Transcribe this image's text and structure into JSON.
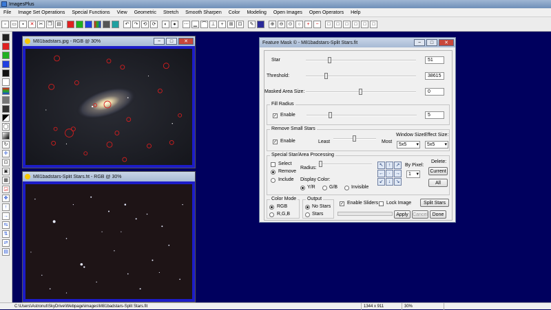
{
  "app": {
    "title": "ImagesPlus"
  },
  "menu": [
    "File",
    "Image Set Operations",
    "Special Functions",
    "View",
    "Geometric",
    "Stretch",
    "Smooth Sharpen",
    "Color",
    "Modeling",
    "Open Images",
    "Open Operators",
    "Help"
  ],
  "window1": {
    "title": "M81badstars.jpg - RGB @ 30%"
  },
  "window2": {
    "title": "M81badstars-Split Stars.fit - RGB @ 30%"
  },
  "dialog": {
    "title": "Feature Mask © - M81badstars-Split Stars.fit",
    "star": {
      "label": "Star",
      "value": "51",
      "level": 0.22
    },
    "threshold": {
      "label": "Threshold:",
      "value": "38615",
      "level": 0.19
    },
    "masked_area": {
      "label": "Masked Area Size:",
      "value": "0",
      "level": 0.5
    },
    "fill_radius": {
      "group": "Fill Radius",
      "enable_label": "Enable",
      "enabled": true,
      "value": "5",
      "level": 0.22
    },
    "remove_small": {
      "group": "Remove Small Stars",
      "enable_label": "Enable",
      "enabled": true,
      "least": "Least",
      "most": "Most",
      "level": 0.5,
      "window_size_label": "Window Size:",
      "window_size": "5x5",
      "effect_size_label": "Effect Size:",
      "effect_size": "5x5"
    },
    "special": {
      "group": "Special Star/Area Processing",
      "select": "Select",
      "remove": "Remove",
      "include": "Include",
      "radius_label": "Radius:",
      "radius_level": 0.05,
      "display_color": "Display Color:",
      "yr": "Y/R",
      "gb": "G/B",
      "invisible": "Invisible",
      "by_pixel": "By Pixel:",
      "by_pixel_value": "1",
      "delete": "Delete:",
      "current": "Current",
      "all": "All"
    },
    "color_mode": {
      "group": "Color Mode",
      "rgb": "RGB",
      "rgb_sep": "R,G,B"
    },
    "output": {
      "group": "Output",
      "no_stars": "No Stars",
      "stars": "Stars"
    },
    "enable_sliders": "Enable Sliders",
    "lock_image": "Lock Image",
    "split_stars": "Split Stars",
    "apply": "Apply",
    "cancel": "Cancel",
    "done": "Done"
  },
  "status": {
    "path": "C:\\Users\\Astronut\\SkyDrive\\Webpage\\images\\M81badstars-Split Stars.fit",
    "dims": "1344 x 911",
    "zoom": "30%"
  },
  "colors": {
    "desktop": "#00005e",
    "window_frame": "#1c1cc8",
    "marker": "#d61e1e"
  }
}
